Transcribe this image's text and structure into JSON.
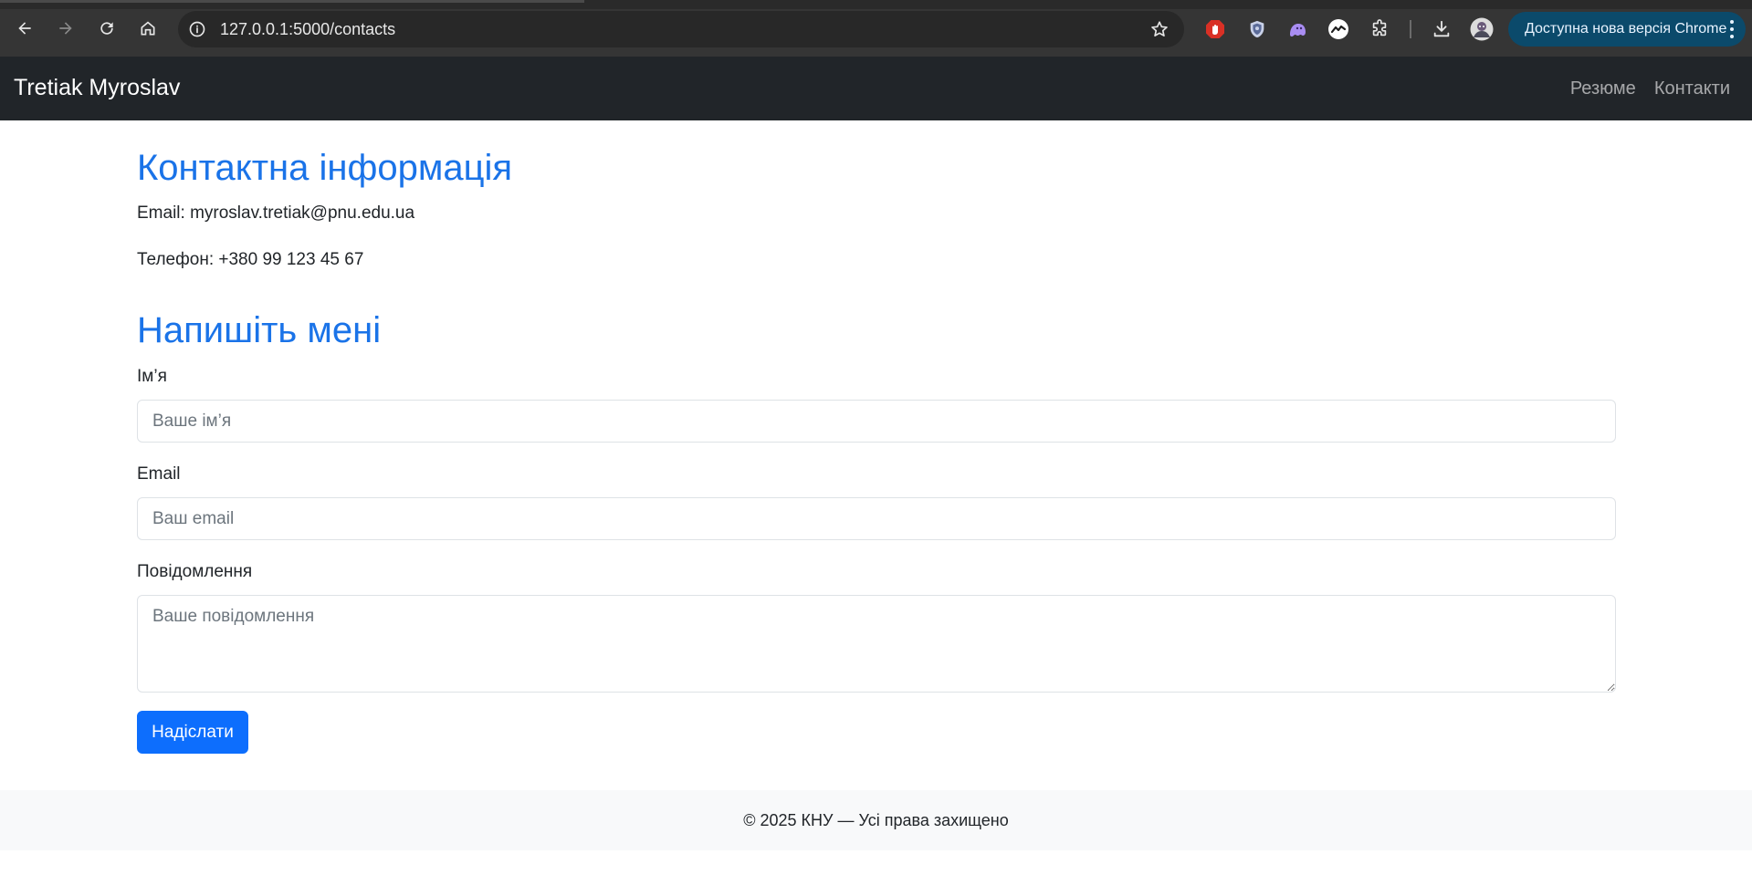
{
  "browser": {
    "url": "127.0.0.1:5000/contacts",
    "update_pill": "Доступна нова версія Chrome",
    "extensions": [
      "adblock-icon",
      "shield-extension-icon",
      "ghost-extension-icon",
      "stats-extension-icon",
      "puzzle-icon"
    ],
    "accent": "#0b4a6b"
  },
  "navbar": {
    "brand": "Tretiak Myroslav",
    "links": [
      "Резюме",
      "Контакти"
    ]
  },
  "contact": {
    "title": "Контактна інформація",
    "email_line": "Email: myroslav.tretiak@pnu.edu.ua",
    "phone_line": "Телефон: +380 99 123 45 67"
  },
  "form": {
    "title": "Напишіть мені",
    "name_label": "Ім’я",
    "name_placeholder": "Ваше ім’я",
    "email_label": "Email",
    "email_placeholder": "Ваш email",
    "message_label": "Повідомлення",
    "message_placeholder": "Ваше повідомлення",
    "submit_label": "Надіслати"
  },
  "footer": {
    "text": "© 2025 КНУ — Усі права захищено"
  },
  "colors": {
    "heading": "#1a73e8",
    "primary_button": "#0d6efd",
    "navbar_bg": "#212529"
  }
}
